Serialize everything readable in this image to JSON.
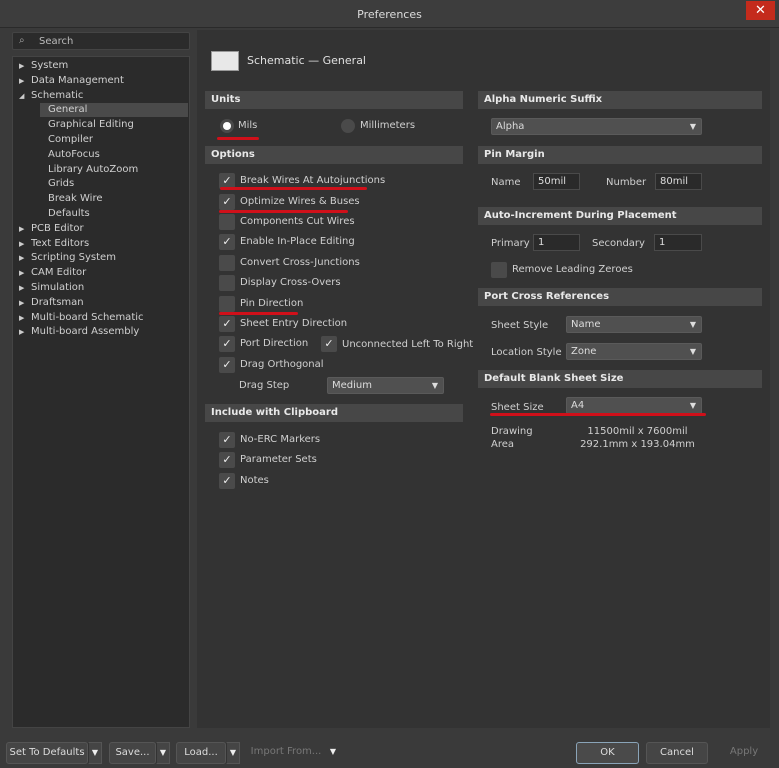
{
  "window": {
    "title": "Preferences",
    "close": "✕"
  },
  "search": {
    "placeholder": "Search",
    "icon": "search-icon"
  },
  "tree": [
    {
      "label": "System",
      "level": 0,
      "expanded": false
    },
    {
      "label": "Data Management",
      "level": 0,
      "expanded": false
    },
    {
      "label": "Schematic",
      "level": 0,
      "expanded": true
    },
    {
      "label": "General",
      "level": 1,
      "selected": true
    },
    {
      "label": "Graphical Editing",
      "level": 1
    },
    {
      "label": "Compiler",
      "level": 1
    },
    {
      "label": "AutoFocus",
      "level": 1
    },
    {
      "label": "Library AutoZoom",
      "level": 1
    },
    {
      "label": "Grids",
      "level": 1
    },
    {
      "label": "Break Wire",
      "level": 1
    },
    {
      "label": "Defaults",
      "level": 1
    },
    {
      "label": "PCB Editor",
      "level": 0,
      "expanded": false
    },
    {
      "label": "Text Editors",
      "level": 0,
      "expanded": false
    },
    {
      "label": "Scripting System",
      "level": 0,
      "expanded": false
    },
    {
      "label": "CAM Editor",
      "level": 0,
      "expanded": false
    },
    {
      "label": "Simulation",
      "level": 0,
      "expanded": false
    },
    {
      "label": "Draftsman",
      "level": 0,
      "expanded": false
    },
    {
      "label": "Multi-board Schematic",
      "level": 0,
      "expanded": false
    },
    {
      "label": "Multi-board Assembly",
      "level": 0,
      "expanded": false
    }
  ],
  "page_title": "Schematic — General",
  "units": {
    "header": "Units",
    "mils": "Mils",
    "millimeters": "Millimeters",
    "selected": "Mils"
  },
  "options": {
    "header": "Options",
    "items": [
      {
        "label": "Break Wires At Autojunctions",
        "checked": true
      },
      {
        "label": "Optimize Wires & Buses",
        "checked": true
      },
      {
        "label": "Components Cut Wires",
        "checked": false
      },
      {
        "label": "Enable In-Place Editing",
        "checked": true
      },
      {
        "label": "Convert Cross-Junctions",
        "checked": false
      },
      {
        "label": "Display Cross-Overs",
        "checked": false
      },
      {
        "label": "Pin Direction",
        "checked": false
      },
      {
        "label": "Sheet Entry Direction",
        "checked": true
      },
      {
        "label": "Port Direction",
        "checked": true
      },
      {
        "label": "Drag Orthogonal",
        "checked": true
      }
    ],
    "unconnected": {
      "label": "Unconnected Left To Right",
      "checked": true
    },
    "drag_step_label": "Drag Step",
    "drag_step": "Medium"
  },
  "clipboard": {
    "header": "Include with Clipboard",
    "items": [
      {
        "label": "No-ERC Markers",
        "checked": true
      },
      {
        "label": "Parameter Sets",
        "checked": true
      },
      {
        "label": "Notes",
        "checked": true
      }
    ]
  },
  "alpha": {
    "header": "Alpha Numeric Suffix",
    "value": "Alpha"
  },
  "pin_margin": {
    "header": "Pin Margin",
    "name_label": "Name",
    "name": "50mil",
    "number_label": "Number",
    "number": "80mil"
  },
  "auto_inc": {
    "header": "Auto-Increment During Placement",
    "primary_label": "Primary",
    "primary": "1",
    "secondary_label": "Secondary",
    "secondary": "1",
    "remove_zeroes": "Remove Leading Zeroes",
    "remove_checked": false
  },
  "port_cross": {
    "header": "Port Cross References",
    "sheet_style_label": "Sheet Style",
    "sheet_style": "Name",
    "location_style_label": "Location Style",
    "location_style": "Zone"
  },
  "sheet": {
    "header": "Default Blank Sheet Size",
    "size_label": "Sheet Size",
    "size": "A4",
    "drawing_label": "Drawing",
    "area_label": "Area",
    "drawing": "11500mil x 7600mil",
    "area": "292.1mm x 193.04mm"
  },
  "footer": {
    "defaults": "Set To Defaults",
    "save": "Save...",
    "load": "Load...",
    "import": "Import From...",
    "ok": "OK",
    "cancel": "Cancel",
    "apply": "Apply"
  }
}
